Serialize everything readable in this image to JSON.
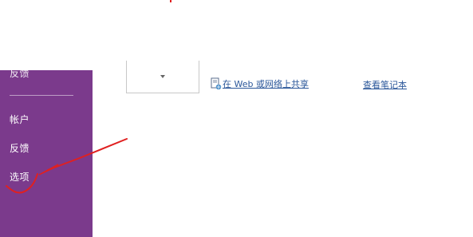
{
  "sidebar": {
    "background": "#7b3a8c",
    "clipped_item_label": "反馈",
    "items": [
      {
        "label": "帐户"
      },
      {
        "label": "反馈"
      },
      {
        "label": "选项"
      }
    ]
  },
  "main": {
    "share_link_label": "在 Web 或网络上共享",
    "share_icon": "share-web-icon",
    "view_notebook_label": "查看笔记本",
    "link_color": "#2b579a"
  },
  "annotation": {
    "color": "#e02020",
    "shape": "arrow-pointing-to-options"
  }
}
